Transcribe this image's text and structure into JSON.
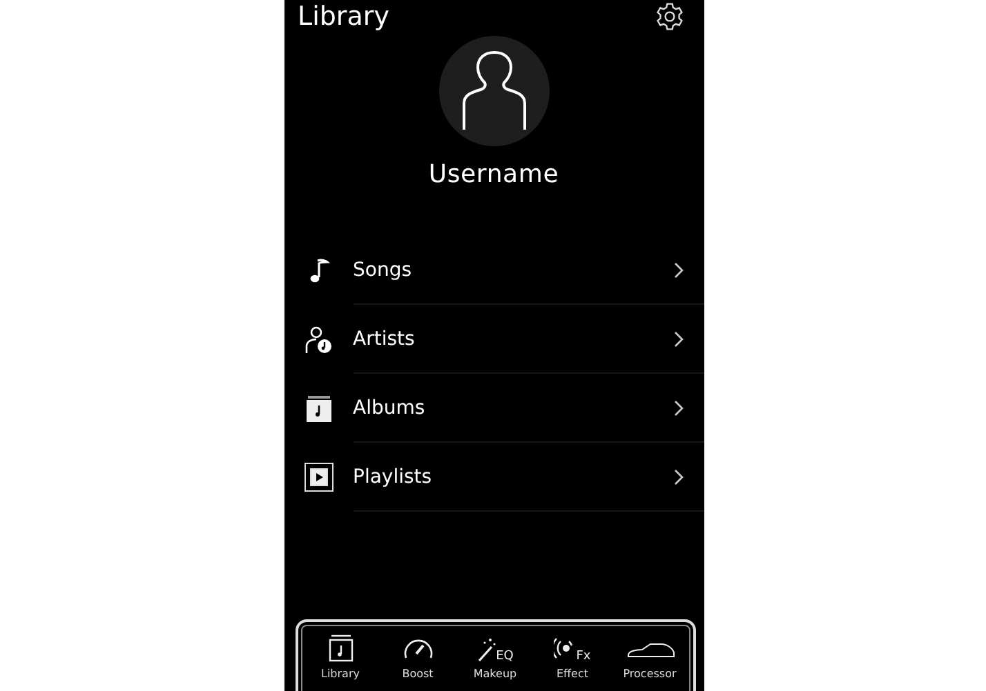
{
  "header": {
    "title": "Library"
  },
  "profile": {
    "username": "Username"
  },
  "menu": [
    {
      "kind": "note",
      "label": "Songs"
    },
    {
      "kind": "artist",
      "label": "Artists"
    },
    {
      "kind": "album",
      "label": "Albums"
    },
    {
      "kind": "playlist",
      "label": "Playlists"
    }
  ],
  "tab_bar": [
    {
      "kind": "library",
      "label": "Library"
    },
    {
      "kind": "boost",
      "label": "Boost"
    },
    {
      "kind": "makeup",
      "label": "Makeup",
      "icon_text": "EQ"
    },
    {
      "kind": "effect",
      "label": "Effect",
      "icon_text": "Fx"
    },
    {
      "kind": "processor",
      "label": "Processor"
    }
  ]
}
